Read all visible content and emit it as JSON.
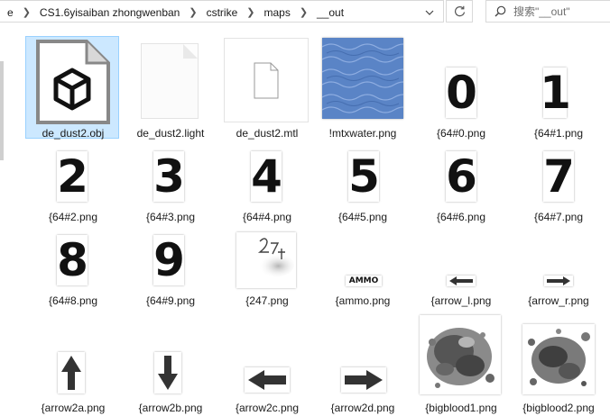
{
  "address_bar": {
    "crumbs": [
      "e",
      "CS1.6yisaiban zhongwenban",
      "cstrike",
      "maps",
      "__out"
    ],
    "search_placeholder": "搜索\"__out\""
  },
  "files": [
    {
      "name": "de_dust2.obj",
      "kind": "obj",
      "selected": true
    },
    {
      "name": "de_dust2.light",
      "kind": "blank"
    },
    {
      "name": "de_dust2.mtl",
      "kind": "doc"
    },
    {
      "name": "!mtxwater.png",
      "kind": "water"
    },
    {
      "name": "{64#0.png",
      "kind": "digit",
      "glyph": "0"
    },
    {
      "name": "{64#1.png",
      "kind": "digit",
      "glyph": "1"
    },
    {
      "name": "{64#2.png",
      "kind": "digit",
      "glyph": "2"
    },
    {
      "name": "{64#3.png",
      "kind": "digit",
      "glyph": "3"
    },
    {
      "name": "{64#4.png",
      "kind": "digit",
      "glyph": "4"
    },
    {
      "name": "{64#5.png",
      "kind": "digit",
      "glyph": "5"
    },
    {
      "name": "{64#6.png",
      "kind": "digit",
      "glyph": "6"
    },
    {
      "name": "{64#7.png",
      "kind": "digit",
      "glyph": "7"
    },
    {
      "name": "{64#8.png",
      "kind": "digit",
      "glyph": "8"
    },
    {
      "name": "{64#9.png",
      "kind": "digit",
      "glyph": "9"
    },
    {
      "name": "{247.png",
      "kind": "sketch"
    },
    {
      "name": "{ammo.png",
      "kind": "ammo",
      "glyph": "AMMO"
    },
    {
      "name": "{arrow_l.png",
      "kind": "arrow-small",
      "dir": "left"
    },
    {
      "name": "{arrow_r.png",
      "kind": "arrow-small",
      "dir": "right"
    },
    {
      "name": "{arrow2a.png",
      "kind": "arrow-big",
      "dir": "up"
    },
    {
      "name": "{arrow2b.png",
      "kind": "arrow-big",
      "dir": "down"
    },
    {
      "name": "{arrow2c.png",
      "kind": "arrow-big",
      "dir": "left"
    },
    {
      "name": "{arrow2d.png",
      "kind": "arrow-big",
      "dir": "right"
    },
    {
      "name": "{bigblood1.png",
      "kind": "blood"
    },
    {
      "name": "{bigblood2.png",
      "kind": "blood"
    }
  ]
}
